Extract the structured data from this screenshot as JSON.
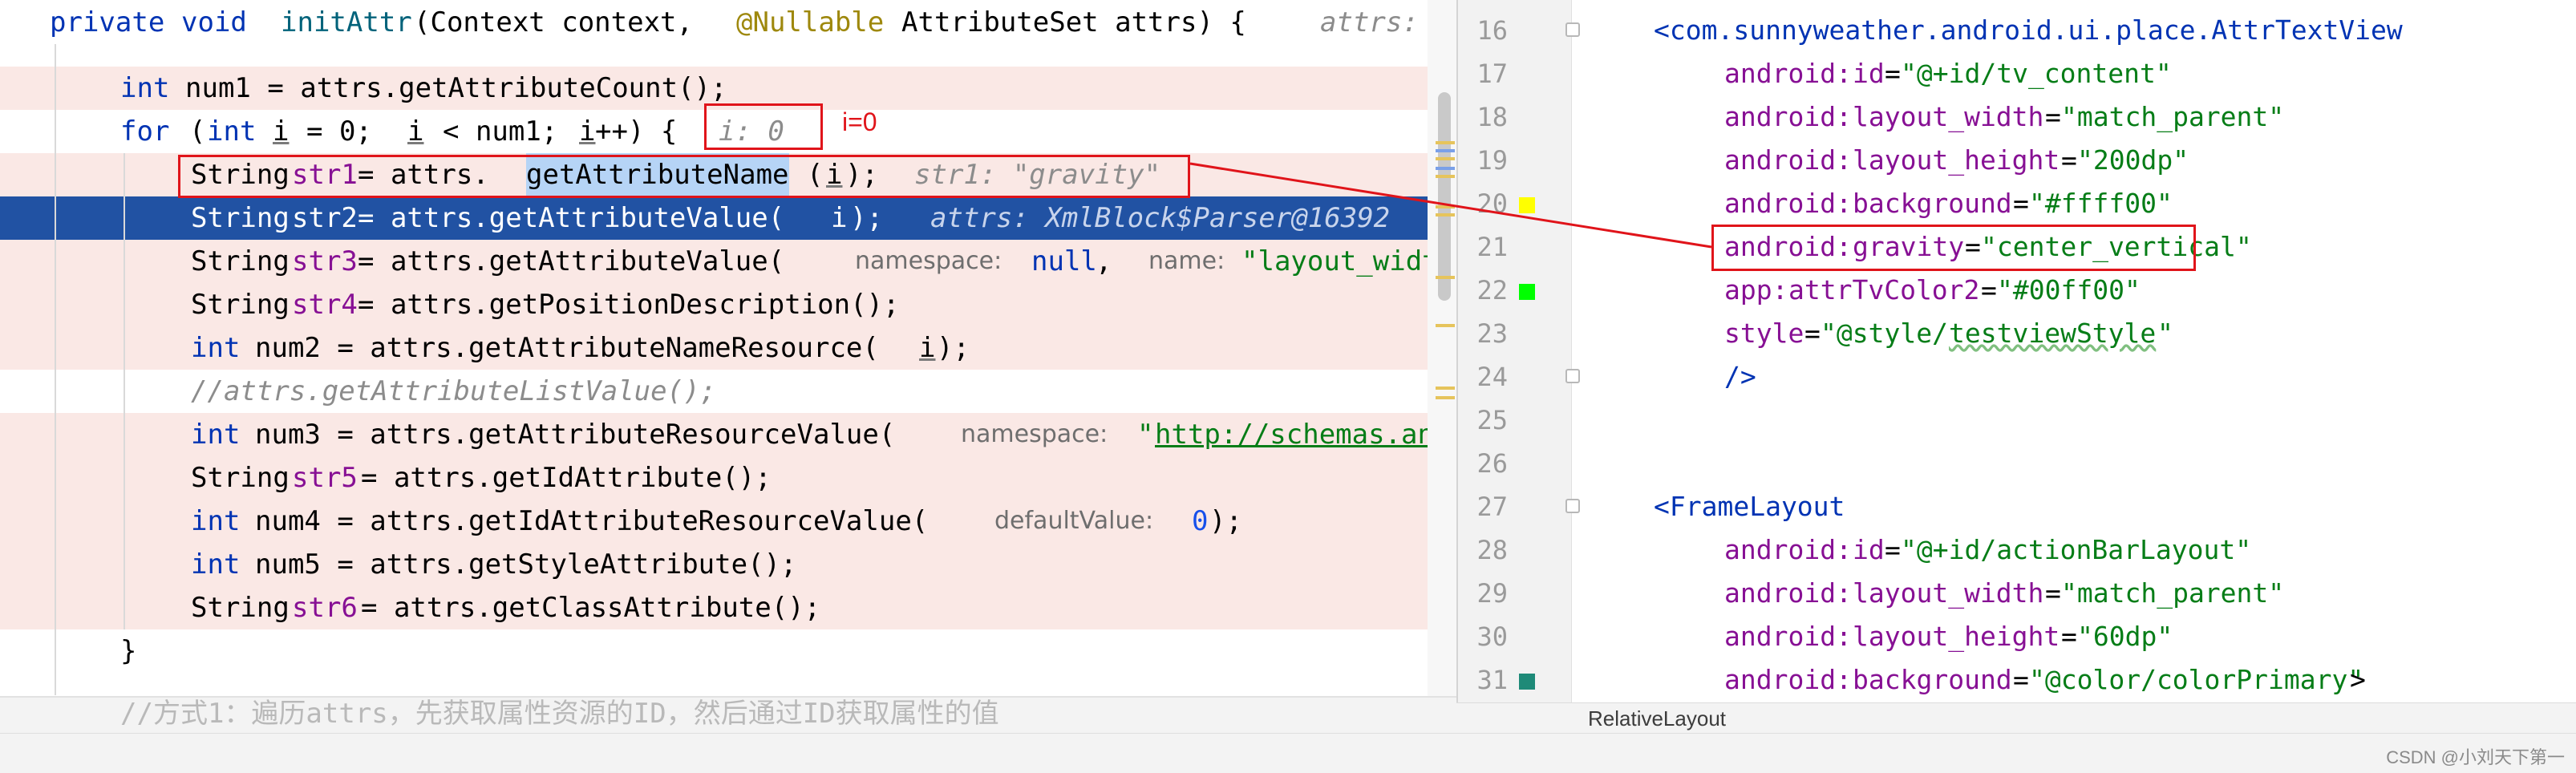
{
  "java_editor": {
    "lines": [
      {
        "t1": "private",
        "t2": "void",
        "t3": "initAttr",
        "t4": "(Context context,",
        "t5": "@Nullable",
        "t6": "AttributeSet attrs) {",
        "inline": "attrs: X"
      },
      {
        "t1": "int",
        "t2": "num1 = attrs.getAttributeCount();"
      },
      {
        "t1": "for",
        "t2": "(",
        "t3": "int",
        "t4": "i",
        "t5": "= 0;",
        "t6": "i",
        "t7": "< num1;",
        "t8": "i",
        "t9": "++) {",
        "inline": "i: 0"
      },
      {
        "t1": "String",
        "t2": "str1",
        "t3": "= attrs.",
        "t4": "getAttributeName",
        "t5": "(",
        "t6": "i",
        "t7": ");",
        "inline": "str1: \"gravity\""
      },
      {
        "t1": "String",
        "t2": "str2",
        "t3": "= attrs.getAttributeValue(",
        "t4": "i",
        "t5": ");",
        "inline": "attrs: XmlBlock$Parser@16392"
      },
      {
        "t1": "String",
        "t2": "str3",
        "t3": "= attrs.getAttributeValue(",
        "hint1": "namespace:",
        "t4": "null",
        "t5": ",",
        "hint2": "name:",
        "t6": "\"layout_widt"
      },
      {
        "t1": "String",
        "t2": "str4",
        "t3": "= attrs.getPositionDescription();"
      },
      {
        "t1": "int",
        "t2": "num2 = attrs.getAttributeNameResource(",
        "t3": "i",
        "t4": ");"
      },
      {
        "t1": "//attrs.getAttributeListValue();"
      },
      {
        "t1": "int",
        "t2": "num3 = attrs.getAttributeResourceValue(",
        "hint1": "namespace:",
        "t3": "\"",
        "t4": "http://schemas.an"
      },
      {
        "t1": "String",
        "t2": "str5",
        "t3": "= attrs.getIdAttribute();"
      },
      {
        "t1": "int",
        "t2": "num4 = attrs.getIdAttributeResourceValue(",
        "hint1": "defaultValue:",
        "t3": "0",
        "t4": ");"
      },
      {
        "t1": "int",
        "t2": "num5 = attrs.getStyleAttribute();"
      },
      {
        "t1": "String",
        "t2": "str6",
        "t3": "= attrs.getClassAttribute();"
      },
      {
        "t1": "}"
      }
    ],
    "bottom_faint": "//方式1：遍历attrs，先获取属性资源的ID，然后通过ID获取属性的值"
  },
  "annotation": {
    "i_eq_0": "i=0"
  },
  "xml_editor": {
    "line_numbers": [
      "16",
      "17",
      "18",
      "19",
      "20",
      "21",
      "22",
      "23",
      "24",
      "25",
      "26",
      "27",
      "28",
      "29",
      "30",
      "31"
    ],
    "lines": [
      {
        "tag": "<com.sunnyweather.android.ui.place.AttrTextView"
      },
      {
        "ns": "android:",
        "name": "id",
        "eq": "=",
        "val": "\"@+id/tv_content\""
      },
      {
        "ns": "android:",
        "name": "layout_width",
        "eq": "=",
        "val": "\"match_parent\""
      },
      {
        "ns": "android:",
        "name": "layout_height",
        "eq": "=",
        "val": "\"200dp\""
      },
      {
        "ns": "android:",
        "name": "background",
        "eq": "=",
        "val": "\"#ffff00\""
      },
      {
        "ns": "android:",
        "name": "gravity",
        "eq": "=",
        "val": "\"center_vertical\""
      },
      {
        "ns": "app:",
        "name": "attrTvColor2",
        "eq": "=",
        "val": "\"#00ff00\""
      },
      {
        "name": "style",
        "eq": "=",
        "val1": "\"@style/",
        "val2": "testviewStyle",
        "val3": "\""
      },
      {
        "tag": "/>"
      },
      {},
      {},
      {
        "tag": "<FrameLayout"
      },
      {
        "ns": "android:",
        "name": "id",
        "eq": "=",
        "val": "\"@+id/actionBarLayout\""
      },
      {
        "ns": "android:",
        "name": "layout_width",
        "eq": "=",
        "val": "\"match_parent\""
      },
      {
        "ns": "android:",
        "name": "layout_height",
        "eq": "=",
        "val": "\"60dp\""
      },
      {
        "ns": "android:",
        "name": "background",
        "eq": "=",
        "val": "\"@color/colorPrimary\"",
        "tail": ">"
      }
    ],
    "gutter_colors": {
      "line20": "#ffff00",
      "line22": "#00ff00",
      "line31": "#1e8a78"
    },
    "breadcrumb": "RelativeLayout"
  },
  "watermark": "CSDN @小刘天下第一"
}
